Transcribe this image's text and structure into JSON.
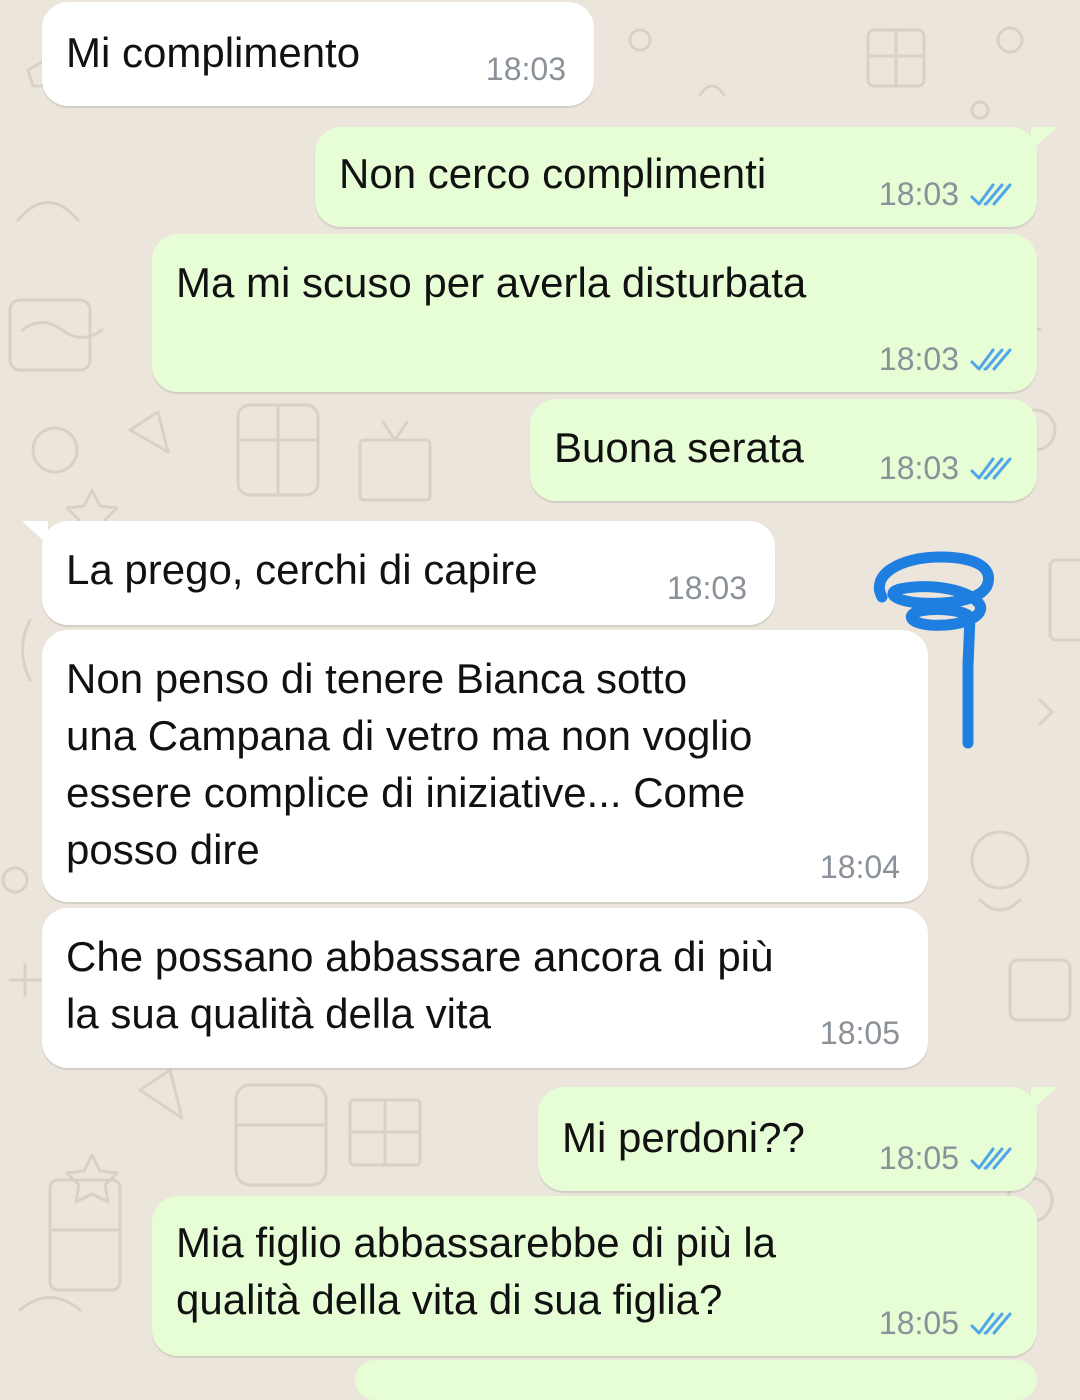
{
  "conversation": {
    "messages": [
      {
        "dir": "in",
        "text": "Mi complimento",
        "time": "18:03"
      },
      {
        "dir": "out",
        "text": "Non cerco complimenti",
        "time": "18:03",
        "status": "read"
      },
      {
        "dir": "out",
        "text": "Ma mi scuso per averla disturbata",
        "time": "18:03",
        "status": "read"
      },
      {
        "dir": "out",
        "text": "Buona serata",
        "time": "18:03",
        "status": "read"
      },
      {
        "dir": "in",
        "text": "La prego, cerchi di capire",
        "time": "18:03"
      },
      {
        "dir": "in",
        "text": "Non penso di tenere Bianca sotto\nuna Campana di vetro ma non voglio\nessere complice di iniziative... Come\nposso dire",
        "time": "18:04"
      },
      {
        "dir": "in",
        "text": "Che possano abbassare ancora di più\nla sua qualità della vita",
        "time": "18:05"
      },
      {
        "dir": "out",
        "text": "Mi perdoni??",
        "time": "18:05",
        "status": "read"
      },
      {
        "dir": "out",
        "text": "Mia figlio abbassarebbe di più la\nqualità della vita di sua figlia?",
        "time": "18:05",
        "status": "read"
      }
    ]
  },
  "theme": {
    "incoming_bubble": "#ffffff",
    "outgoing_bubble": "#e7fdd6",
    "read_ticks": "#4fa6e8",
    "annotation_stroke": "#1f7fe0",
    "read_status_icon": "double-check-icon"
  }
}
